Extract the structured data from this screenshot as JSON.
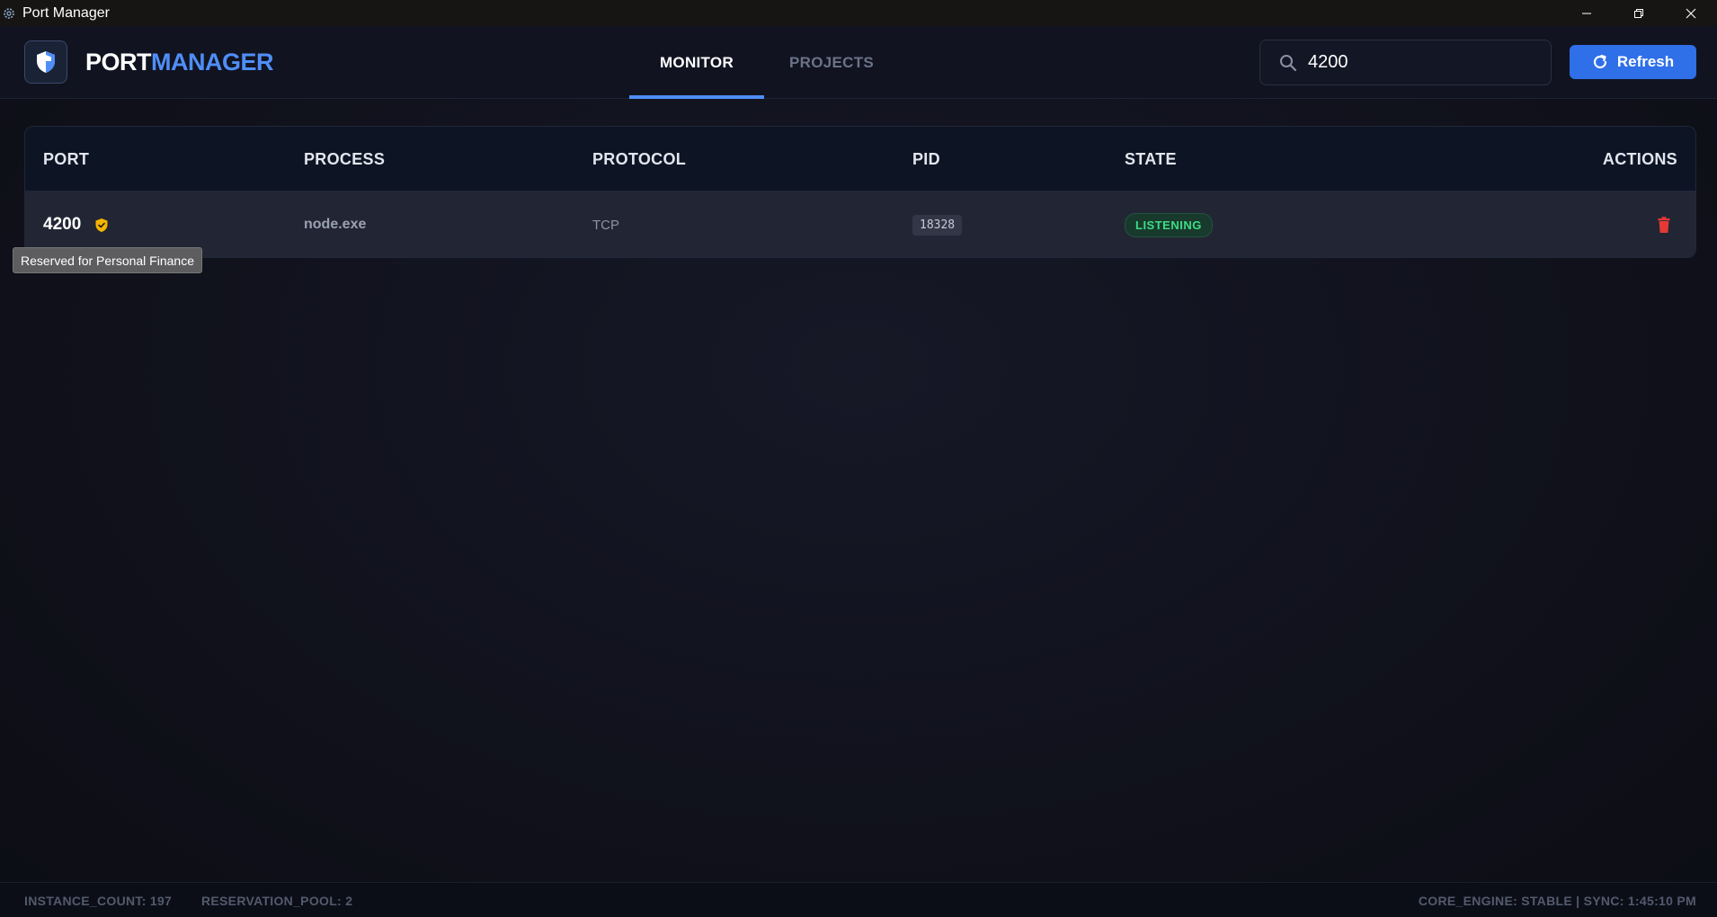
{
  "window": {
    "title": "Port Manager"
  },
  "header": {
    "brand_part1": "PORT",
    "brand_part2": "MANAGER",
    "tabs": [
      {
        "label": "MONITOR",
        "active": true
      },
      {
        "label": "PROJECTS",
        "active": false
      }
    ],
    "search": {
      "value": "4200",
      "placeholder": ""
    },
    "refresh_label": "Refresh"
  },
  "table": {
    "columns": [
      "PORT",
      "PROCESS",
      "PROTOCOL",
      "PID",
      "STATE",
      "ACTIONS"
    ],
    "rows": [
      {
        "port": "4200",
        "reserved": true,
        "process": "node.exe",
        "protocol": "TCP",
        "pid": "18328",
        "state": "LISTENING"
      }
    ]
  },
  "tooltip": {
    "text": "Reserved for Personal Finance"
  },
  "footer": {
    "instance_count": "INSTANCE_COUNT: 197",
    "reservation_pool": "RESERVATION_POOL: 2",
    "engine_status": "CORE_ENGINE: STABLE | SYNC: 1:45:10 PM"
  },
  "colors": {
    "accent": "#4f8ef7",
    "button": "#2f6fe8",
    "listening": "#3ddc84",
    "reserved": "#f5b400",
    "delete": "#e53935"
  },
  "icons": {
    "app": "gear-icon",
    "logo": "shield-icon",
    "search": "search-icon",
    "refresh": "refresh-icon",
    "reserved": "shield-check-icon",
    "delete": "trash-icon"
  }
}
